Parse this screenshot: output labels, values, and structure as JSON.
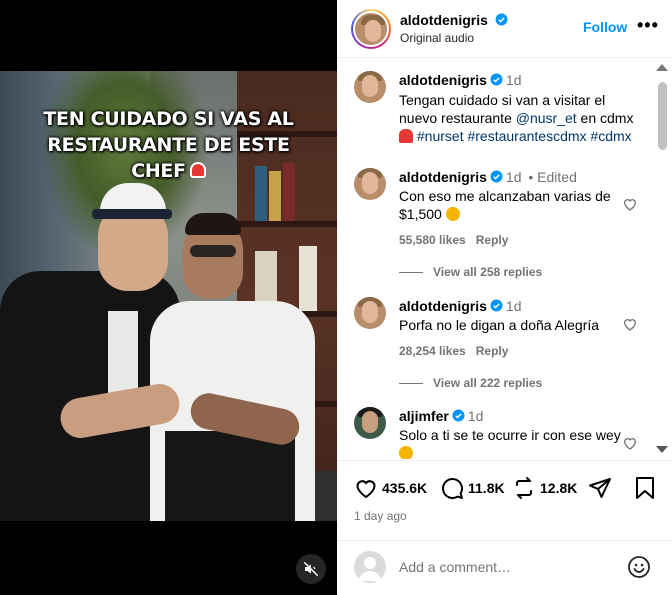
{
  "video": {
    "caption_lines": [
      "TEN CUIDADO SI VAS AL",
      "RESTAURANTE DE ESTE",
      "CHEF"
    ],
    "mute_icon": "speaker-muted-icon"
  },
  "header": {
    "username": "aldotdenigris",
    "subtitle": "Original audio",
    "follow_label": "Follow",
    "more_label": "•••"
  },
  "caption": {
    "username": "aldotdenigris",
    "time": "1d",
    "text_before": "Tengan cuidado si van a visitar el nuevo restaurante ",
    "mention": "@nusr_et",
    "text_after": " en cdmx",
    "hashtags": "#nurset #restaurantescdmx #cdmx"
  },
  "comments": [
    {
      "username": "aldotdenigris",
      "time": "1d",
      "edited": "• Edited",
      "text": "Con eso me alcanzaban varias de $1,500",
      "likes": "55,580 likes",
      "reply_label": "Reply",
      "view_replies": "View all 258 replies"
    },
    {
      "username": "aldotdenigris",
      "time": "1d",
      "text": "Porfa no le digan a doña Alegría",
      "likes": "28,254 likes",
      "reply_label": "Reply",
      "view_replies": "View all 222 replies"
    },
    {
      "username": "aljimfer",
      "time": "1d",
      "text": "Solo a ti se te ocurre ir con ese wey"
    }
  ],
  "actions": {
    "likes": "435.6K",
    "comments": "11.8K",
    "reposts": "12.8K",
    "date": "1 day ago"
  },
  "composer": {
    "placeholder": "Add a comment…"
  },
  "colors": {
    "accent": "#0095f6",
    "verified": "#0095f6",
    "link": "#00376b",
    "muted_text": "#737373"
  }
}
